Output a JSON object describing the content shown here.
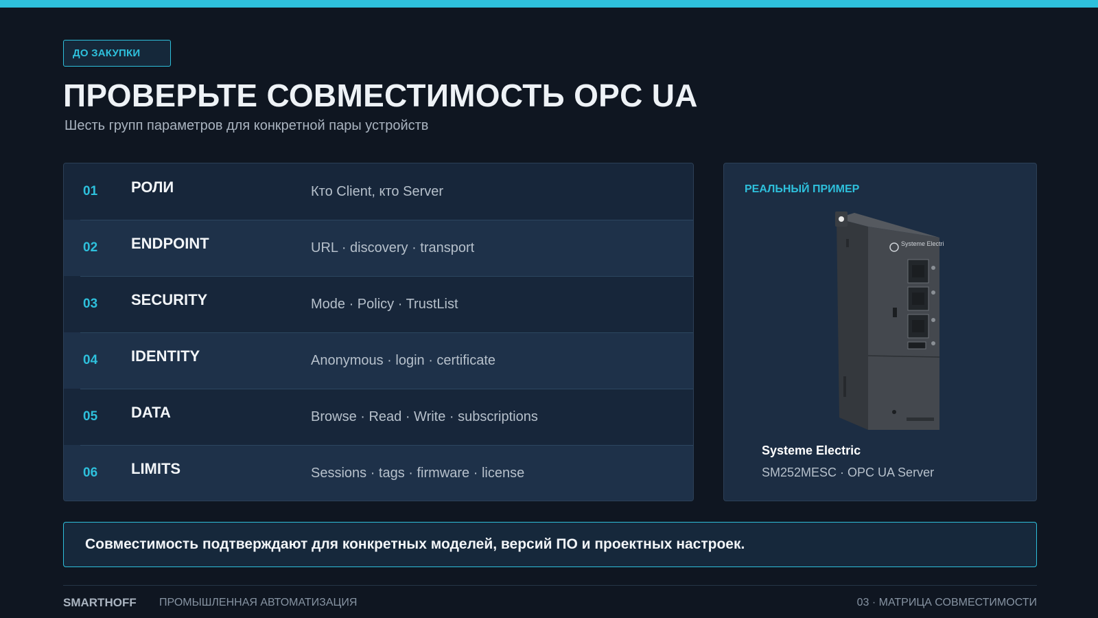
{
  "accent_color": "#2ec0dc",
  "header": {
    "tag": "ДО ЗАКУПКИ",
    "title": "ПРОВЕРЬТЕ СОВМЕСТИМОСТЬ OPC UA",
    "subtitle": "Шесть групп параметров для конкретной пары устройств"
  },
  "rows": [
    {
      "num": "01",
      "name": "РОЛИ",
      "desc": "Кто Client, кто Server"
    },
    {
      "num": "02",
      "name": "ENDPOINT",
      "desc": "URL · discovery · transport"
    },
    {
      "num": "03",
      "name": "SECURITY",
      "desc": "Mode · Policy · TrustList"
    },
    {
      "num": "04",
      "name": "IDENTITY",
      "desc": "Anonymous · login · certificate"
    },
    {
      "num": "05",
      "name": "DATA",
      "desc": "Browse · Read · Write · subscriptions"
    },
    {
      "num": "06",
      "name": "LIMITS",
      "desc": "Sessions · tags · firmware · license"
    }
  ],
  "example": {
    "label": "РЕАЛЬНЫЙ ПРИМЕР",
    "device_brand_print": "Systeme Electric",
    "brand": "Systeme Electric",
    "model": "SM252MESC · OPC UA Server"
  },
  "note": "Совместимость подтверждают для конкретных моделей, версий ПО и проектных настроек.",
  "footer": {
    "brand": "SMARTHOFF",
    "subtitle": "ПРОМЫШЛЕННАЯ АВТОМАТИЗАЦИЯ",
    "page": "03 · МАТРИЦА СОВМЕСТИМОСТИ"
  }
}
